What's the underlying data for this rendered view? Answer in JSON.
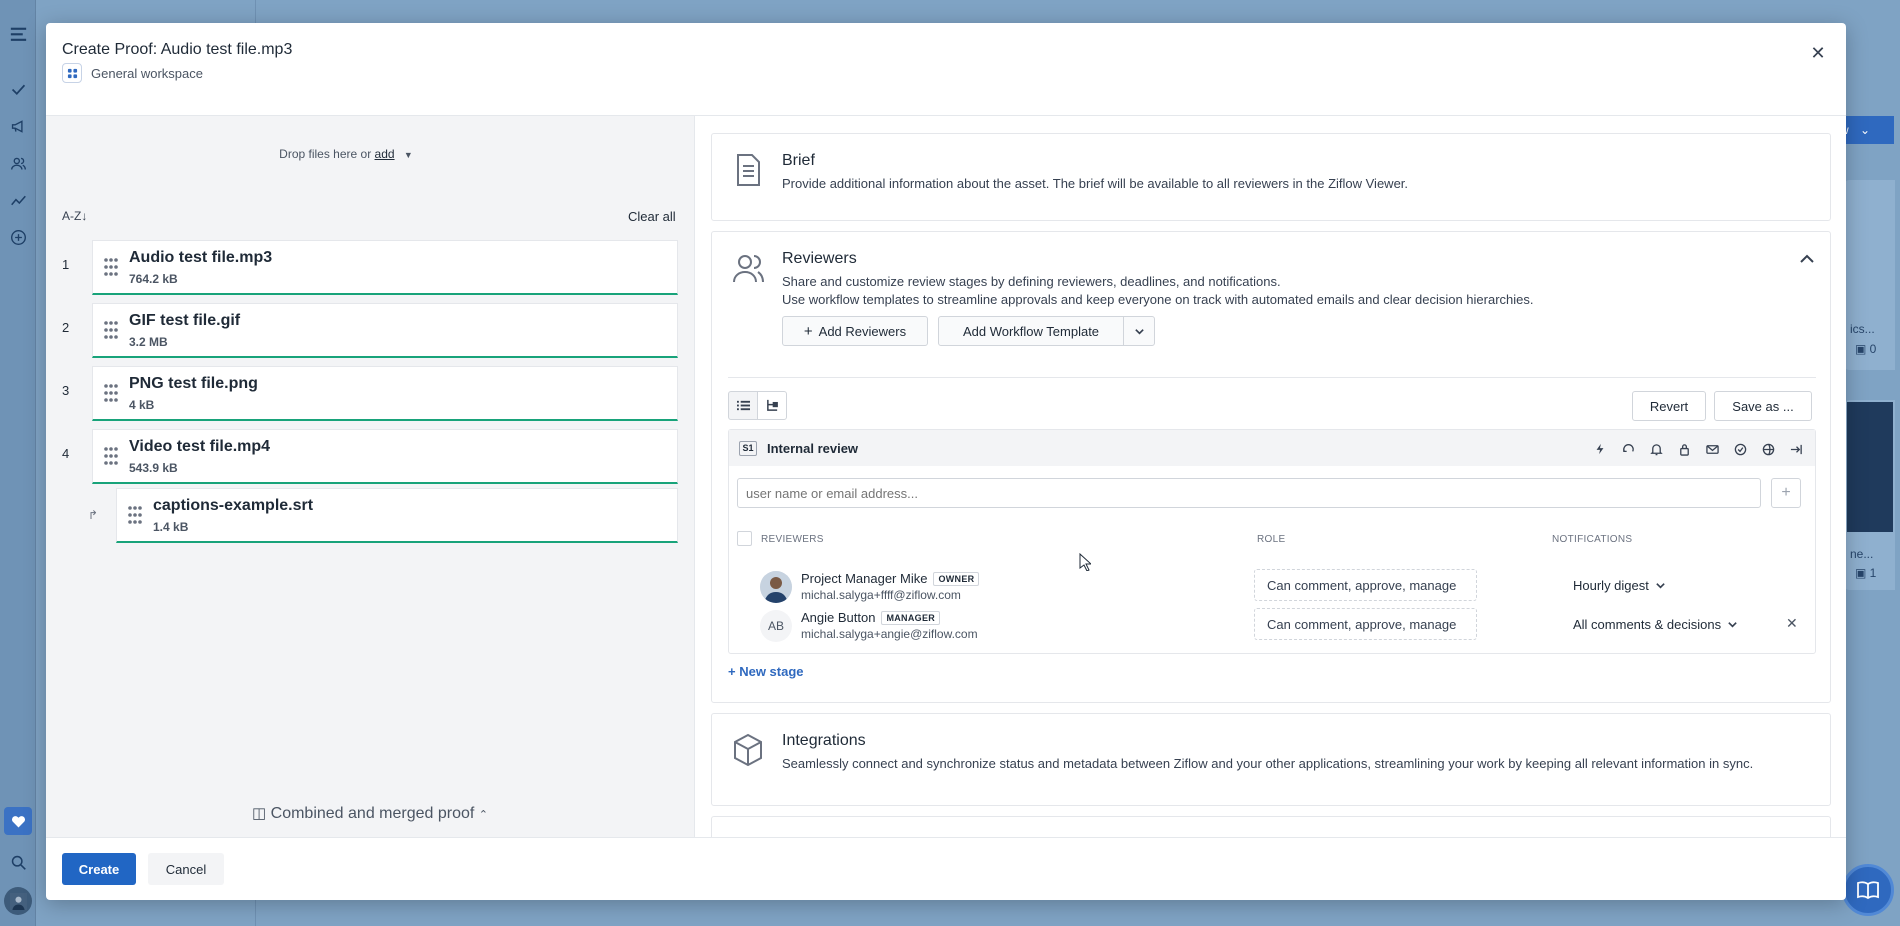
{
  "modal": {
    "title": "Create Proof:  Audio test file.mp3",
    "workspace": "General workspace"
  },
  "files": {
    "drop_text": "Drop files here or ",
    "drop_link": "add",
    "sort_label": "A-Z↓",
    "clear_all": "Clear all",
    "items": [
      {
        "index": "1",
        "name": "Audio test file.mp3",
        "size": "764.2 kB"
      },
      {
        "index": "2",
        "name": "GIF test file.gif",
        "size": "3.2 MB"
      },
      {
        "index": "3",
        "name": "PNG test file.png",
        "size": "4 kB"
      },
      {
        "index": "4",
        "name": "Video test file.mp4",
        "size": "543.9 kB"
      }
    ],
    "sub_item": {
      "name": "captions-example.srt",
      "size": "1.4 kB"
    },
    "combined_label": "Combined and merged proof"
  },
  "brief": {
    "title": "Brief",
    "desc": "Provide additional information about the asset. The brief will be available to all reviewers in the Ziflow Viewer."
  },
  "reviewers": {
    "title": "Reviewers",
    "desc1": "Share and customize review stages by defining reviewers, deadlines, and notifications.",
    "desc2": "Use workflow templates to streamline approvals and keep everyone on track with automated emails and clear decision hierarchies.",
    "add_reviewers": "Add Reviewers",
    "add_workflow_template": "Add Workflow Template",
    "revert": "Revert",
    "save_as": "Save as ...",
    "stage": {
      "badge": "S1",
      "name": "Internal review",
      "input_placeholder": "user name or email address...",
      "col_reviewers": "REVIEWERS",
      "col_role": "ROLE",
      "col_notifications": "NOTIFICATIONS",
      "rows": [
        {
          "name": "Project Manager Mike",
          "tag": "OWNER",
          "email": "michal.salyga+ffff@ziflow.com",
          "role": "Can comment, approve, manage",
          "notifications": "Hourly digest",
          "initials": ""
        },
        {
          "name": "Angie Button",
          "tag": "MANAGER",
          "email": "michal.salyga+angie@ziflow.com",
          "role": "Can comment, approve, manage",
          "notifications": "All comments & decisions",
          "initials": "AB"
        }
      ]
    },
    "new_stage": "New stage"
  },
  "integrations": {
    "title": "Integrations",
    "desc": "Seamlessly connect and synchronize status and metadata between Ziflow and your other applications, streamlining your work by keeping all relevant information in sync."
  },
  "footer": {
    "create": "Create",
    "cancel": "Cancel"
  },
  "background": {
    "button_fragment": "w",
    "card1_text": "ics...",
    "card1_count": "0",
    "card2_text": "ne...",
    "card2_count": "1"
  }
}
